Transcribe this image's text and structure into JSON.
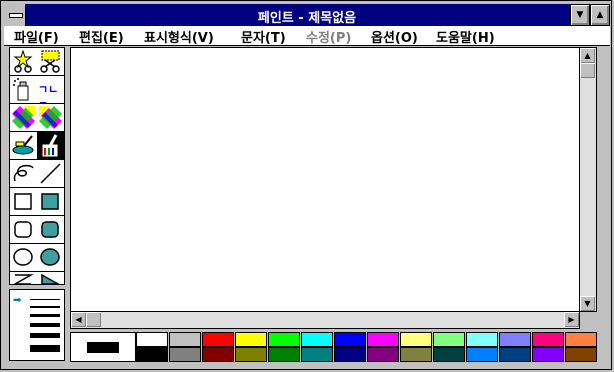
{
  "window": {
    "title": "페인트 - 제목없음",
    "minimize_glyph": "▼",
    "maximize_glyph": "▲"
  },
  "menu": [
    {
      "label": "파일(F)",
      "enabled": true
    },
    {
      "label": "편집(E)",
      "enabled": true
    },
    {
      "label": "표시형식(V)",
      "enabled": true
    },
    {
      "label": "문자(T)",
      "enabled": true
    },
    {
      "label": "수정(P)",
      "enabled": false
    },
    {
      "label": "옵션(O)",
      "enabled": true
    },
    {
      "label": "도움말(H)",
      "enabled": true
    }
  ],
  "tools": {
    "text_tool_label": "ㄱㄴㄷ",
    "items": [
      "scissors-star-icon",
      "scissors-rect-icon",
      "spray-can-icon",
      "text-icon",
      "color-eraser-icon",
      "eraser-icon",
      "paint-roller-icon",
      "brush-icon",
      "curve-icon",
      "line-icon",
      "rectangle-icon",
      "filled-rectangle-icon",
      "rounded-rect-icon",
      "filled-rounded-rect-icon",
      "ellipse-icon",
      "filled-ellipse-icon",
      "polygon-icon",
      "filled-polygon-icon"
    ],
    "selected": "brush-icon"
  },
  "linewidth": {
    "selected_index": 0,
    "marker_glyph": "➡"
  },
  "scroll_glyphs": {
    "up": "▲",
    "down": "▼",
    "left": "◀",
    "right": "▶"
  },
  "palette": {
    "foreground": "#000000",
    "background": "#ffffff",
    "top_row": [
      "#ffffff",
      "#c0c0c0",
      "#ff0000",
      "#ffff00",
      "#00ff00",
      "#00ffff",
      "#0000ff",
      "#ff00ff",
      "#ffff80",
      "#80ff80",
      "#80ffff",
      "#8080ff",
      "#ff0080",
      "#ff8040"
    ],
    "bottom_row": [
      "#000000",
      "#808080",
      "#800000",
      "#808000",
      "#008000",
      "#008080",
      "#000080",
      "#800080",
      "#808040",
      "#004040",
      "#0080ff",
      "#004080",
      "#8000ff",
      "#804000"
    ]
  }
}
